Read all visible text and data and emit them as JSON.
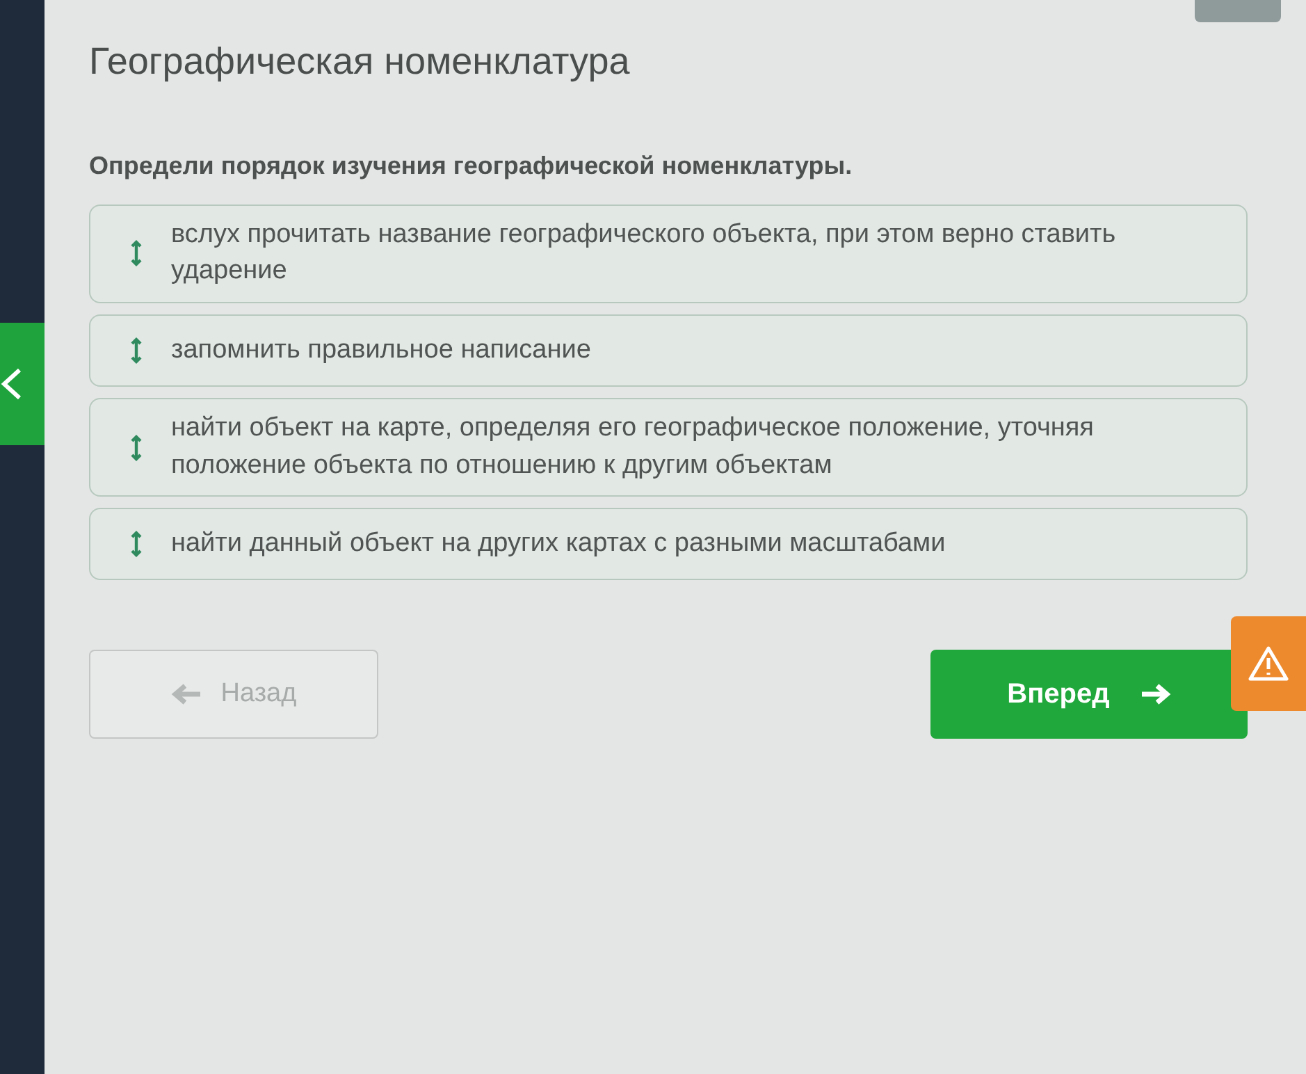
{
  "title": "Географическая номенклатура",
  "question": "Определи порядок изучения географической номенклатуры.",
  "items": [
    {
      "text": "вслух прочитать название географического объекта, при этом верно ставить ударение"
    },
    {
      "text": "запомнить правильное написание"
    },
    {
      "text": "найти объект на карте, определяя его географическое положение, уточняя положение объекта по отношению к другим объектам"
    },
    {
      "text": "найти данный объект на других картах с разными масштабами"
    }
  ],
  "back_button": {
    "label": "Назад",
    "disabled": true
  },
  "next_button": {
    "label": "Вперед",
    "disabled": false
  }
}
